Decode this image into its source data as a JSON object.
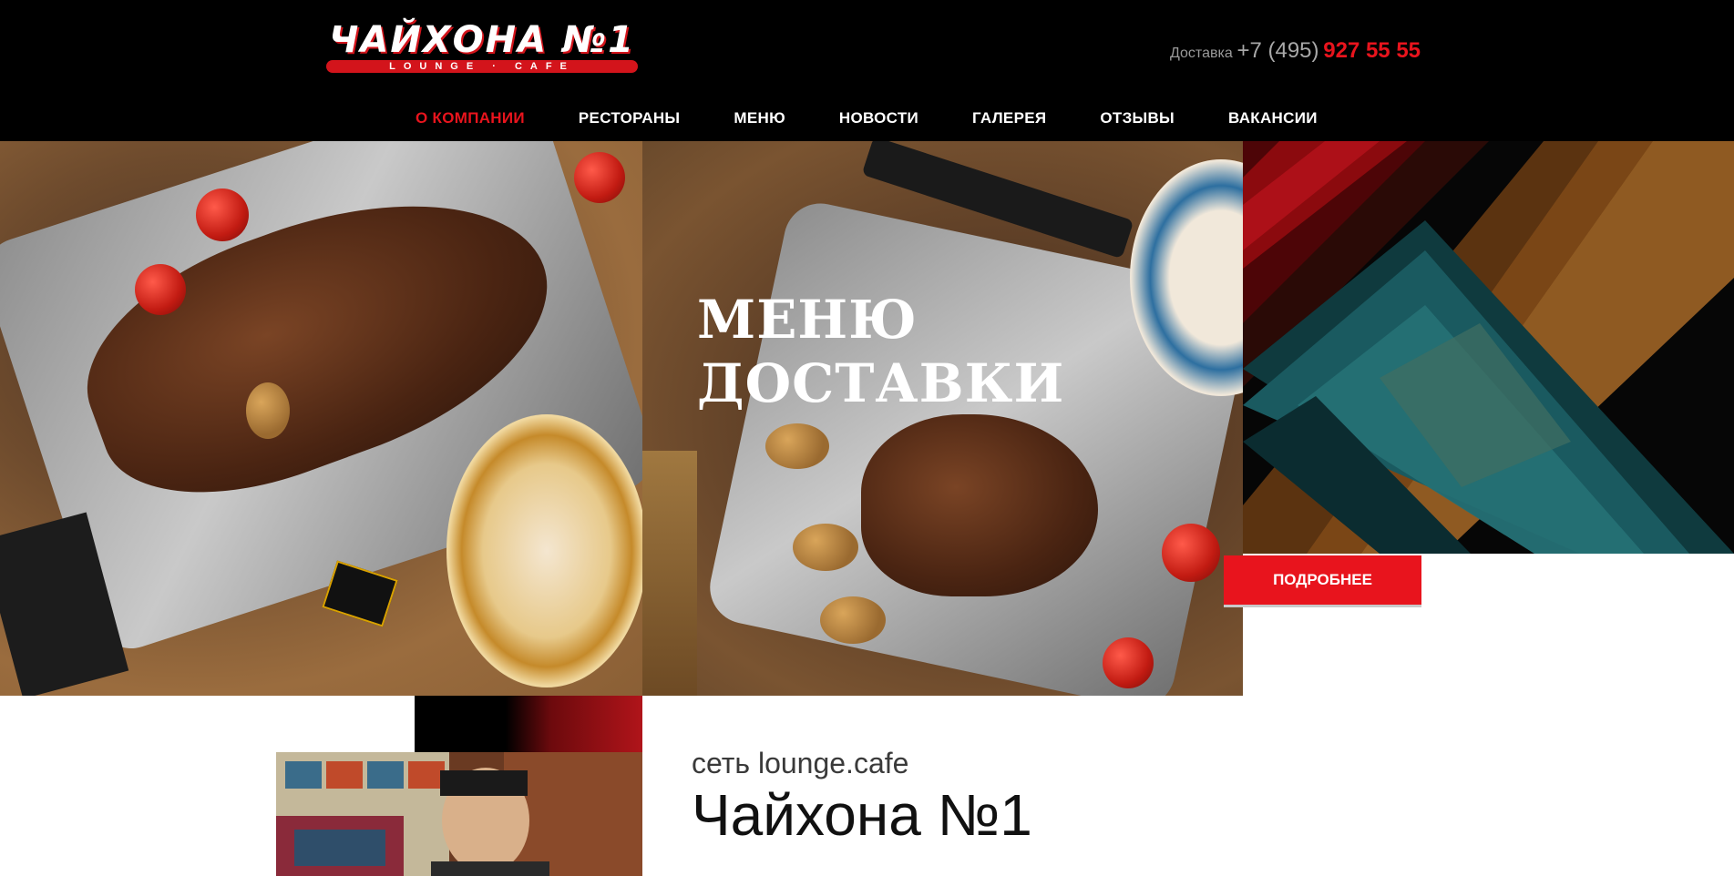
{
  "brand": {
    "logo_text": "ЧАЙХОНА №1",
    "logo_subtext": "LOUNGE · CAFE"
  },
  "header": {
    "delivery_label": "Доставка",
    "phone_code": "+7 (495)",
    "phone_number": "927 55 55"
  },
  "nav": [
    {
      "label": "О КОМПАНИИ",
      "active": true
    },
    {
      "label": "РЕСТОРАНЫ",
      "active": false
    },
    {
      "label": "МЕНЮ",
      "active": false
    },
    {
      "label": "НОВОСТИ",
      "active": false
    },
    {
      "label": "ГАЛЕРЕЯ",
      "active": false
    },
    {
      "label": "ОТЗЫВЫ",
      "active": false
    },
    {
      "label": "ВАКАНСИИ",
      "active": false
    }
  ],
  "hero": {
    "title_line1": "МЕНЮ",
    "title_line2": "ДОСТАВКИ",
    "button_label": "ПОДРОБНЕЕ"
  },
  "about": {
    "subtitle": "сеть lounge.cafe",
    "title": "Чайхона №1"
  },
  "colors": {
    "accent": "#e8141d",
    "header_bg": "#000000",
    "pattern_red": "#8b0a0e",
    "pattern_teal": "#1a5a60",
    "pattern_brown": "#7a4616"
  }
}
